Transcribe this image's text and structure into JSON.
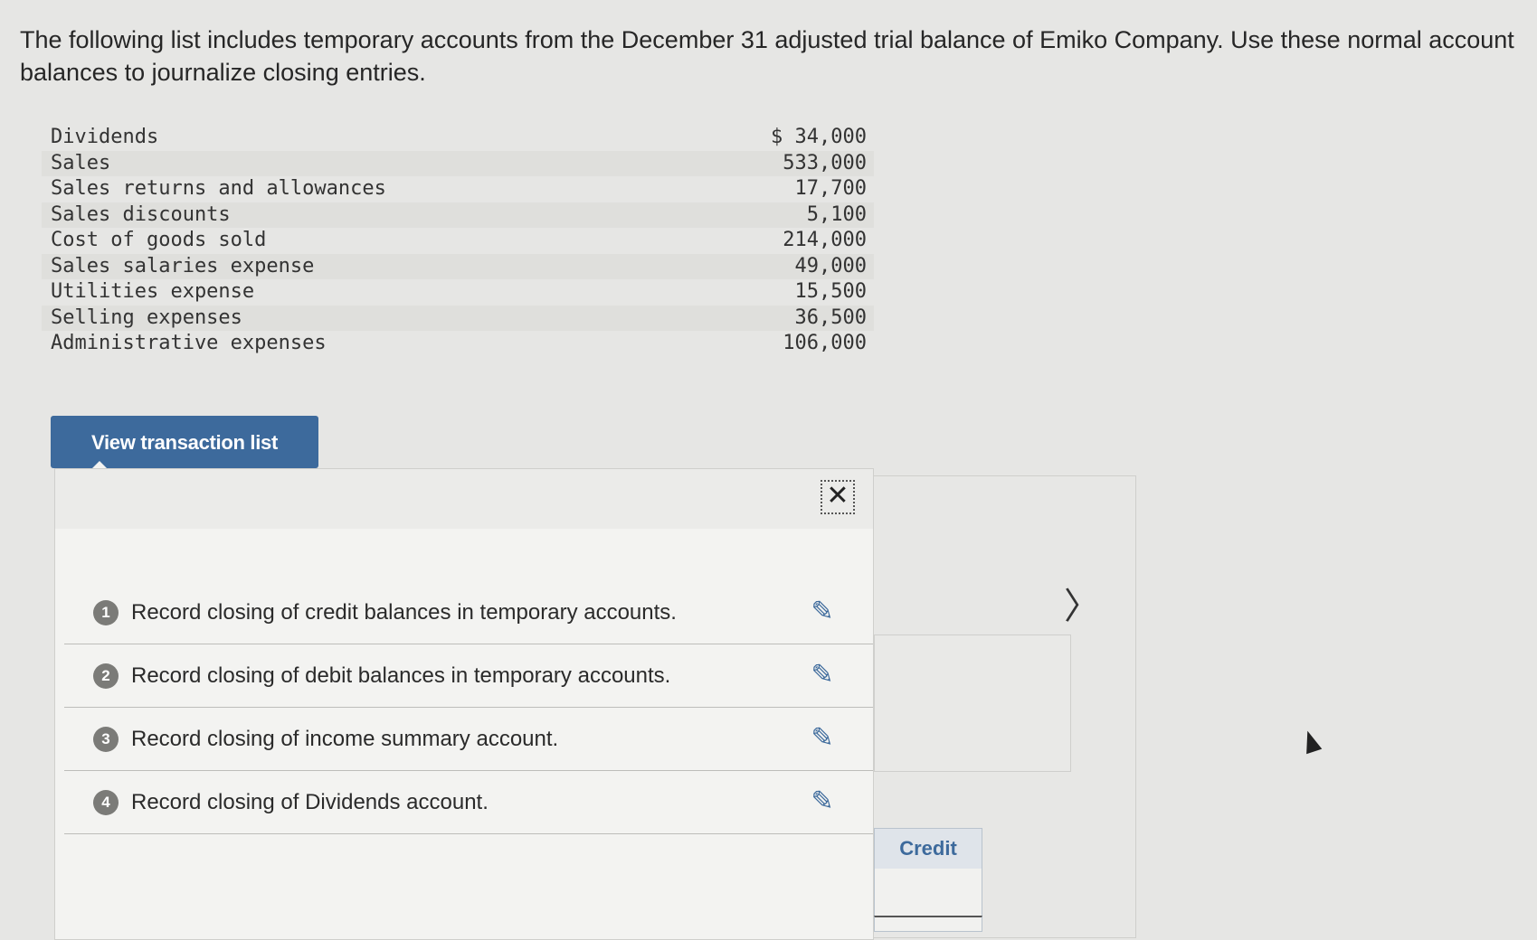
{
  "prompt": "The following list includes temporary accounts from the December 31 adjusted trial balance of Emiko Company. Use these normal account balances to journalize closing entries.",
  "balances": [
    {
      "account": "Dividends",
      "amount": "$ 34,000"
    },
    {
      "account": "Sales",
      "amount": "533,000"
    },
    {
      "account": "Sales returns and allowances",
      "amount": "17,700"
    },
    {
      "account": "Sales discounts",
      "amount": "5,100"
    },
    {
      "account": "Cost of goods sold",
      "amount": "214,000"
    },
    {
      "account": "Sales salaries expense",
      "amount": "49,000"
    },
    {
      "account": "Utilities expense",
      "amount": "15,500"
    },
    {
      "account": "Selling expenses",
      "amount": "36,500"
    },
    {
      "account": "Administrative expenses",
      "amount": "106,000"
    }
  ],
  "view_button": "View transaction list",
  "popup": {
    "close_glyph": "✕",
    "tasks": [
      {
        "number": "1",
        "label": "Record closing of credit balances in temporary accounts."
      },
      {
        "number": "2",
        "label": "Record closing of debit balances in temporary accounts."
      },
      {
        "number": "3",
        "label": "Record closing of income summary account."
      },
      {
        "number": "4",
        "label": "Record closing of Dividends account."
      }
    ],
    "edit_glyph": "✎"
  },
  "next_glyph": "〉",
  "credit_header": "Credit",
  "colors": {
    "accent": "#3d6a9c",
    "background": "#e6e6e4"
  }
}
